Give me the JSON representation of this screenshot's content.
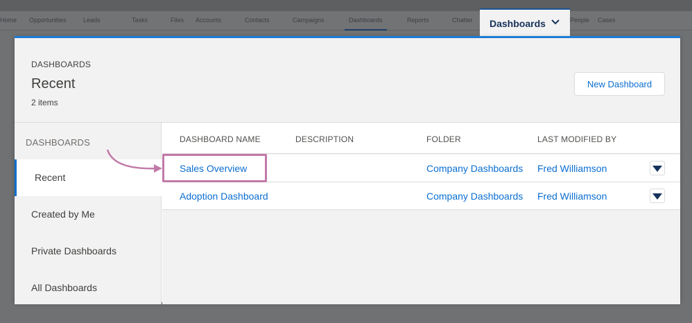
{
  "background_nav": {
    "items": [
      {
        "label": "Home"
      },
      {
        "label": "Opportunities"
      },
      {
        "label": "Leads"
      },
      {
        "label": "Tasks"
      },
      {
        "label": "Files"
      },
      {
        "label": "Accounts"
      },
      {
        "label": "Contacts"
      },
      {
        "label": "Campaigns"
      },
      {
        "label": "Dashboards"
      },
      {
        "label": "Reports"
      },
      {
        "label": "Chatter"
      },
      {
        "label": "People"
      },
      {
        "label": "Cases"
      }
    ]
  },
  "nav_tab": {
    "label": "Dashboards"
  },
  "panel": {
    "object_label": "DASHBOARDS",
    "view_title": "Recent",
    "item_count": "2 items",
    "new_button": "New Dashboard"
  },
  "sidebar": {
    "heading": "DASHBOARDS",
    "items": [
      {
        "label": "Recent",
        "active": true
      },
      {
        "label": "Created by Me"
      },
      {
        "label": "Private Dashboards"
      },
      {
        "label": "All Dashboards"
      }
    ]
  },
  "table": {
    "columns": [
      "DASHBOARD NAME",
      "DESCRIPTION",
      "FOLDER",
      "LAST MODIFIED BY"
    ],
    "rows": [
      {
        "name": "Sales Overview",
        "description": "",
        "folder": "Company Dashboards",
        "modified_by": "Fred Williamson"
      },
      {
        "name": "Adoption Dashboard",
        "description": "",
        "folder": "Company Dashboards",
        "modified_by": "Fred Williamson"
      }
    ]
  },
  "colors": {
    "accent": "#0b6ed0",
    "highlight": "#c17aa8"
  }
}
